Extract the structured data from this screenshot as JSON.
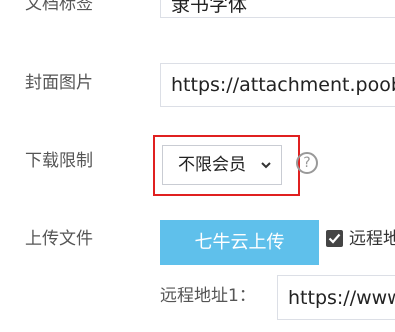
{
  "form": {
    "doc_tag": {
      "label": "文档标签",
      "value": "隶书字体"
    },
    "cover_image": {
      "label": "封面图片",
      "value": "https://attachment.poob"
    },
    "download_limit": {
      "label": "下载限制",
      "selected": "不限会员",
      "help_glyph": "?",
      "highlight_color": "#e02020"
    },
    "upload_file": {
      "label": "上传文件",
      "button": "七牛云上传",
      "button_color": "#5fc0eb",
      "checkbox_checked": true,
      "checkbox_label": "远程地",
      "remote_label": "远程地址1：",
      "remote_value": "https://www"
    }
  }
}
